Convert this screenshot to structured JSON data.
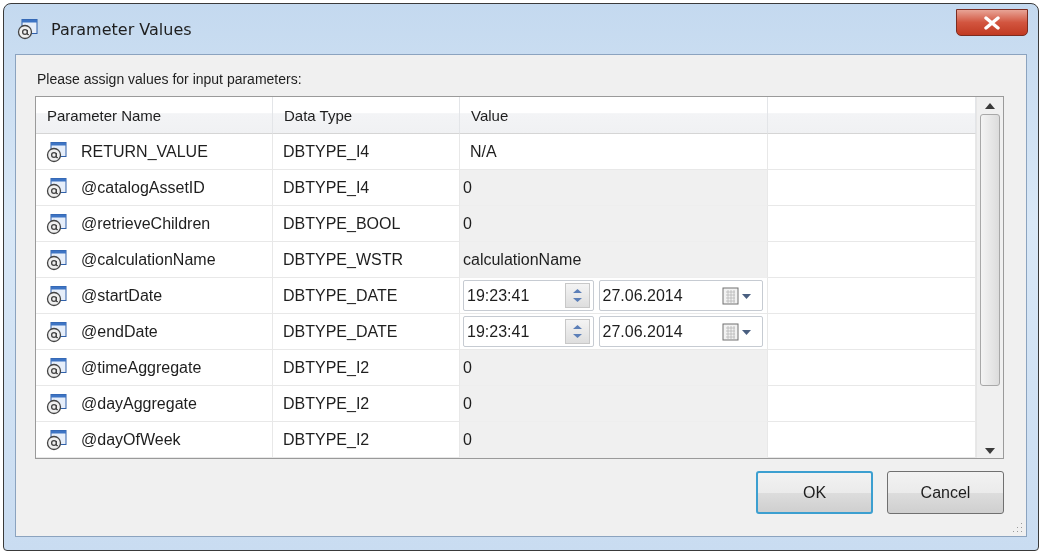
{
  "window": {
    "title": "Parameter Values"
  },
  "prompt": "Please assign values for input parameters:",
  "table": {
    "columns": [
      "Parameter Name",
      "Data Type",
      "Value"
    ],
    "rows": [
      {
        "name": "RETURN_VALUE",
        "type": "DBTYPE_I4",
        "value": {
          "kind": "text",
          "text": "N/A"
        }
      },
      {
        "name": "@catalogAssetID",
        "type": "DBTYPE_I4",
        "value": {
          "kind": "readonly",
          "text": "0"
        }
      },
      {
        "name": "@retrieveChildren",
        "type": "DBTYPE_BOOL",
        "value": {
          "kind": "readonly",
          "text": "0"
        }
      },
      {
        "name": "@calculationName",
        "type": "DBTYPE_WSTR",
        "value": {
          "kind": "readonly",
          "text": "calculationName"
        }
      },
      {
        "name": "@startDate",
        "type": "DBTYPE_DATE",
        "value": {
          "kind": "datetime",
          "time": "19:23:41",
          "date": "27.06.2014"
        }
      },
      {
        "name": "@endDate",
        "type": "DBTYPE_DATE",
        "value": {
          "kind": "datetime",
          "time": "19:23:41",
          "date": "27.06.2014"
        }
      },
      {
        "name": "@timeAggregate",
        "type": "DBTYPE_I2",
        "value": {
          "kind": "readonly",
          "text": "0"
        }
      },
      {
        "name": "@dayAggregate",
        "type": "DBTYPE_I2",
        "value": {
          "kind": "readonly",
          "text": "0"
        }
      },
      {
        "name": "@dayOfWeek",
        "type": "DBTYPE_I2",
        "value": {
          "kind": "readonly",
          "text": "0"
        }
      }
    ]
  },
  "buttons": [
    {
      "label": "OK",
      "default": true
    },
    {
      "label": "Cancel",
      "default": false
    }
  ]
}
